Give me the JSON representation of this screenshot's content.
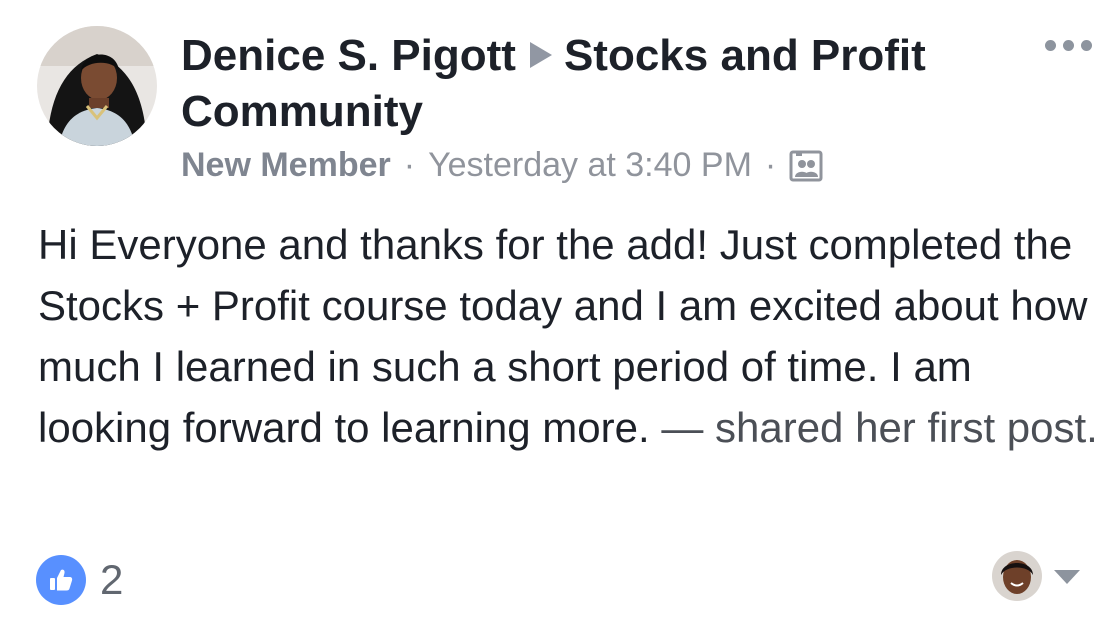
{
  "post": {
    "author_name": "Denice S. Pigott",
    "group_name": "Stocks and Profit Community",
    "role_label": "New Member",
    "separator": "·",
    "timestamp": "Yesterday at 3:40 PM",
    "body": "Hi Everyone and thanks for the add! Just completed the Stocks + Profit course today and I am excited about how much I learned in such a short period of time. I am looking forward to learning more.",
    "body_suffix": " — shared her first post.",
    "like_count": "2"
  },
  "icons": {
    "arrow": "play-arrow-icon",
    "more": "more-horizontal-icon",
    "audience": "group-members-icon",
    "like": "thumbs-up-icon",
    "caret": "caret-down-icon"
  },
  "colors": {
    "like_badge": "#5890ff",
    "text_primary": "#1d2129",
    "text_meta": "#90949c"
  }
}
